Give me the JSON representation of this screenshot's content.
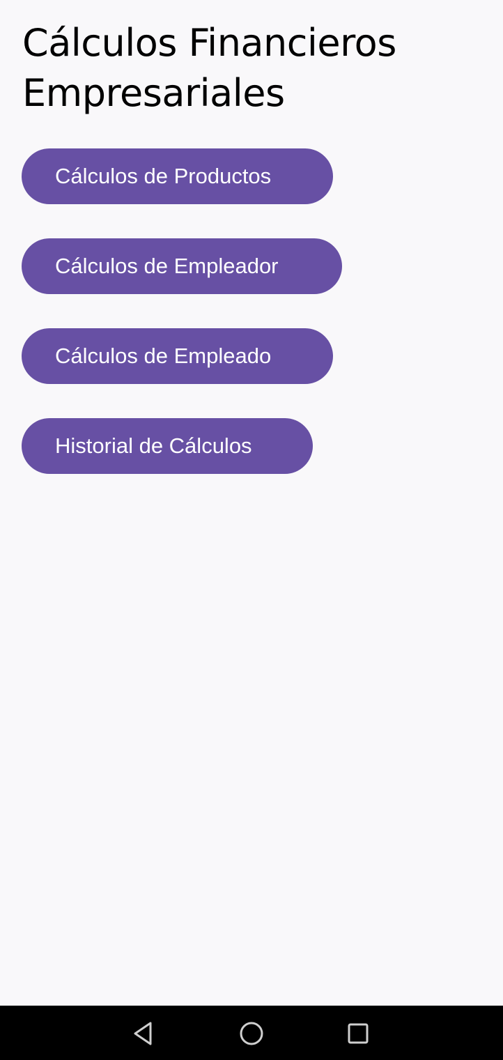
{
  "header": {
    "title": "Cálculos Financieros Empresariales"
  },
  "menu": {
    "items": [
      {
        "label": "Cálculos de Productos"
      },
      {
        "label": "Cálculos de Empleador"
      },
      {
        "label": "Cálculos de Empleado"
      },
      {
        "label": "Historial de Cálculos"
      }
    ]
  },
  "navigation_bar": {
    "buttons": [
      {
        "icon": "back-triangle-icon"
      },
      {
        "icon": "home-circle-icon"
      },
      {
        "icon": "recents-square-icon"
      }
    ]
  },
  "colors": {
    "accent": "#6750a4",
    "background": "#f9f8fa",
    "nav_bar": "#000000",
    "button_text": "#ffffff"
  }
}
